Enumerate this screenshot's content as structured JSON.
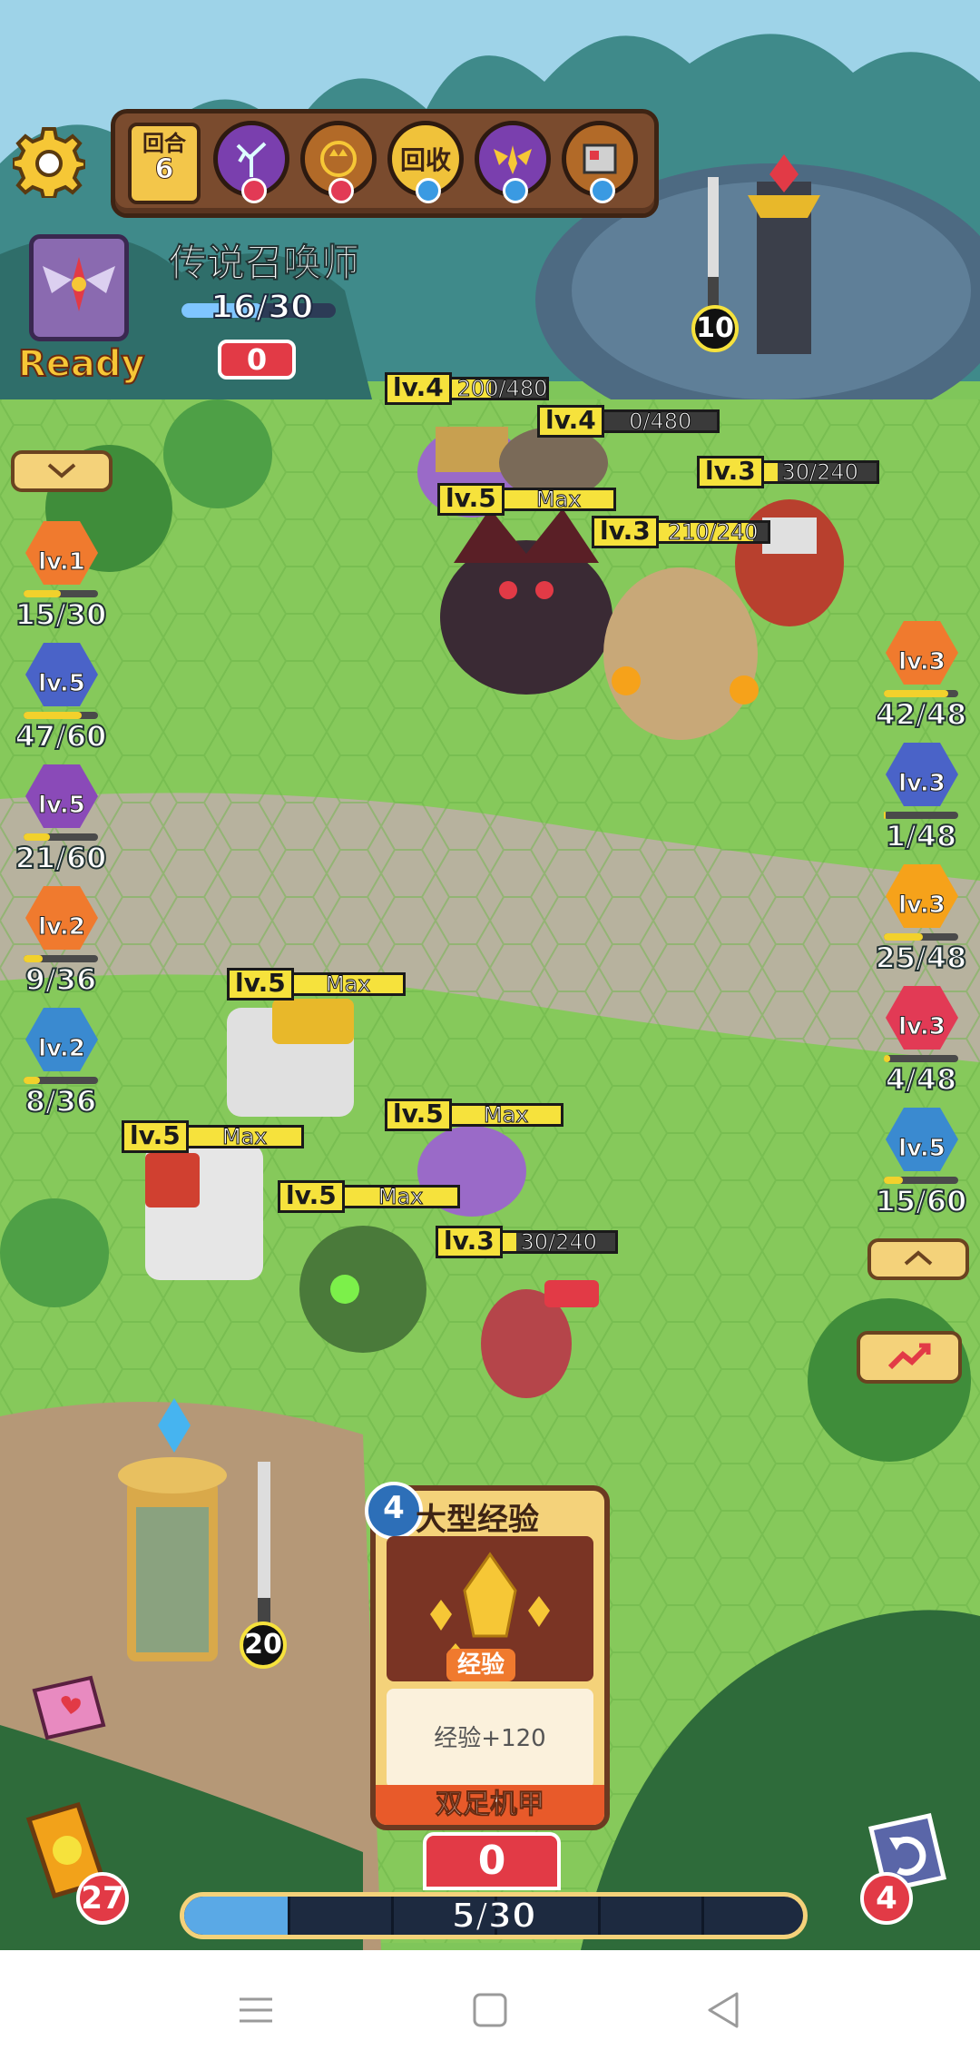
{
  "hud": {
    "round_label": "回合",
    "round_number": "6",
    "skills": [
      {
        "icon": "tree-branch-skill-icon",
        "gem": "red"
      },
      {
        "icon": "crown-wreath-skill-icon",
        "gem": "red"
      },
      {
        "icon": "recycle-skill-icon",
        "label": "回收",
        "gem": "blue"
      },
      {
        "icon": "winged-emblem-skill-icon",
        "gem": "blue"
      },
      {
        "icon": "machine-parts-skill-icon",
        "gem": "blue"
      }
    ],
    "colors": {
      "gem_red": "#e23a55",
      "gem_blue": "#3a9ae2",
      "accent_yellow": "#f6e23c"
    }
  },
  "player": {
    "status": "Ready",
    "name": "传说召唤师",
    "hp": "16/30",
    "hp_fraction": 0.53,
    "shield": "0"
  },
  "left_units": [
    {
      "level": "lv.1",
      "count": "15/30",
      "fill": 0.5,
      "color": "#f07a2e"
    },
    {
      "level": "lv.5",
      "count": "47/60",
      "fill": 0.78,
      "color": "#4a63c8"
    },
    {
      "level": "lv.5",
      "count": "21/60",
      "fill": 0.35,
      "color": "#8a4ab8"
    },
    {
      "level": "lv.2",
      "count": "9/36",
      "fill": 0.25,
      "color": "#f07a2e"
    },
    {
      "level": "lv.2",
      "count": "8/36",
      "fill": 0.22,
      "color": "#3a8ad0"
    }
  ],
  "right_units": [
    {
      "level": "lv.3",
      "count": "42/48",
      "fill": 0.87,
      "color": "#f07a2e"
    },
    {
      "level": "lv.3",
      "count": "1/48",
      "fill": 0.02,
      "color": "#4a63c8"
    },
    {
      "level": "lv.3",
      "count": "25/48",
      "fill": 0.52,
      "color": "#f6a21a"
    },
    {
      "level": "lv.3",
      "count": "4/48",
      "fill": 0.08,
      "color": "#e23a55"
    },
    {
      "level": "lv.5",
      "count": "15/60",
      "fill": 0.25,
      "color": "#3a8ad0"
    }
  ],
  "enemy_tags": [
    {
      "level": "lv.4",
      "value": "200/480",
      "fill": 0.42
    },
    {
      "level": "lv.4",
      "value": "0/480",
      "fill": 0.0
    },
    {
      "level": "lv.3",
      "value": "30/240",
      "fill": 0.12
    },
    {
      "level": "lv.5",
      "value": "Max",
      "fill": 1.0
    },
    {
      "level": "lv.3",
      "value": "210/240",
      "fill": 0.87
    }
  ],
  "ally_tags": [
    {
      "level": "lv.5",
      "value": "Max",
      "fill": 1.0
    },
    {
      "level": "lv.5",
      "value": "Max",
      "fill": 1.0
    },
    {
      "level": "lv.5",
      "value": "Max",
      "fill": 1.0
    },
    {
      "level": "lv.5",
      "value": "Max",
      "fill": 1.0
    },
    {
      "level": "lv.3",
      "value": "30/240",
      "fill": 0.12
    }
  ],
  "towers": {
    "enemy_count": "10",
    "ally_count": "20"
  },
  "card": {
    "cost": "4",
    "title": "大型经验",
    "tag": "经验",
    "description": "经验+120",
    "footer": "双足机甲"
  },
  "bottom": {
    "card_zero": "0",
    "energy": "5/30",
    "energy_fraction": 0.167,
    "deck_count": "27",
    "discard_count": "4"
  },
  "navbar": {
    "icons": [
      "menu-icon",
      "home-square-icon",
      "back-triangle-icon"
    ]
  }
}
